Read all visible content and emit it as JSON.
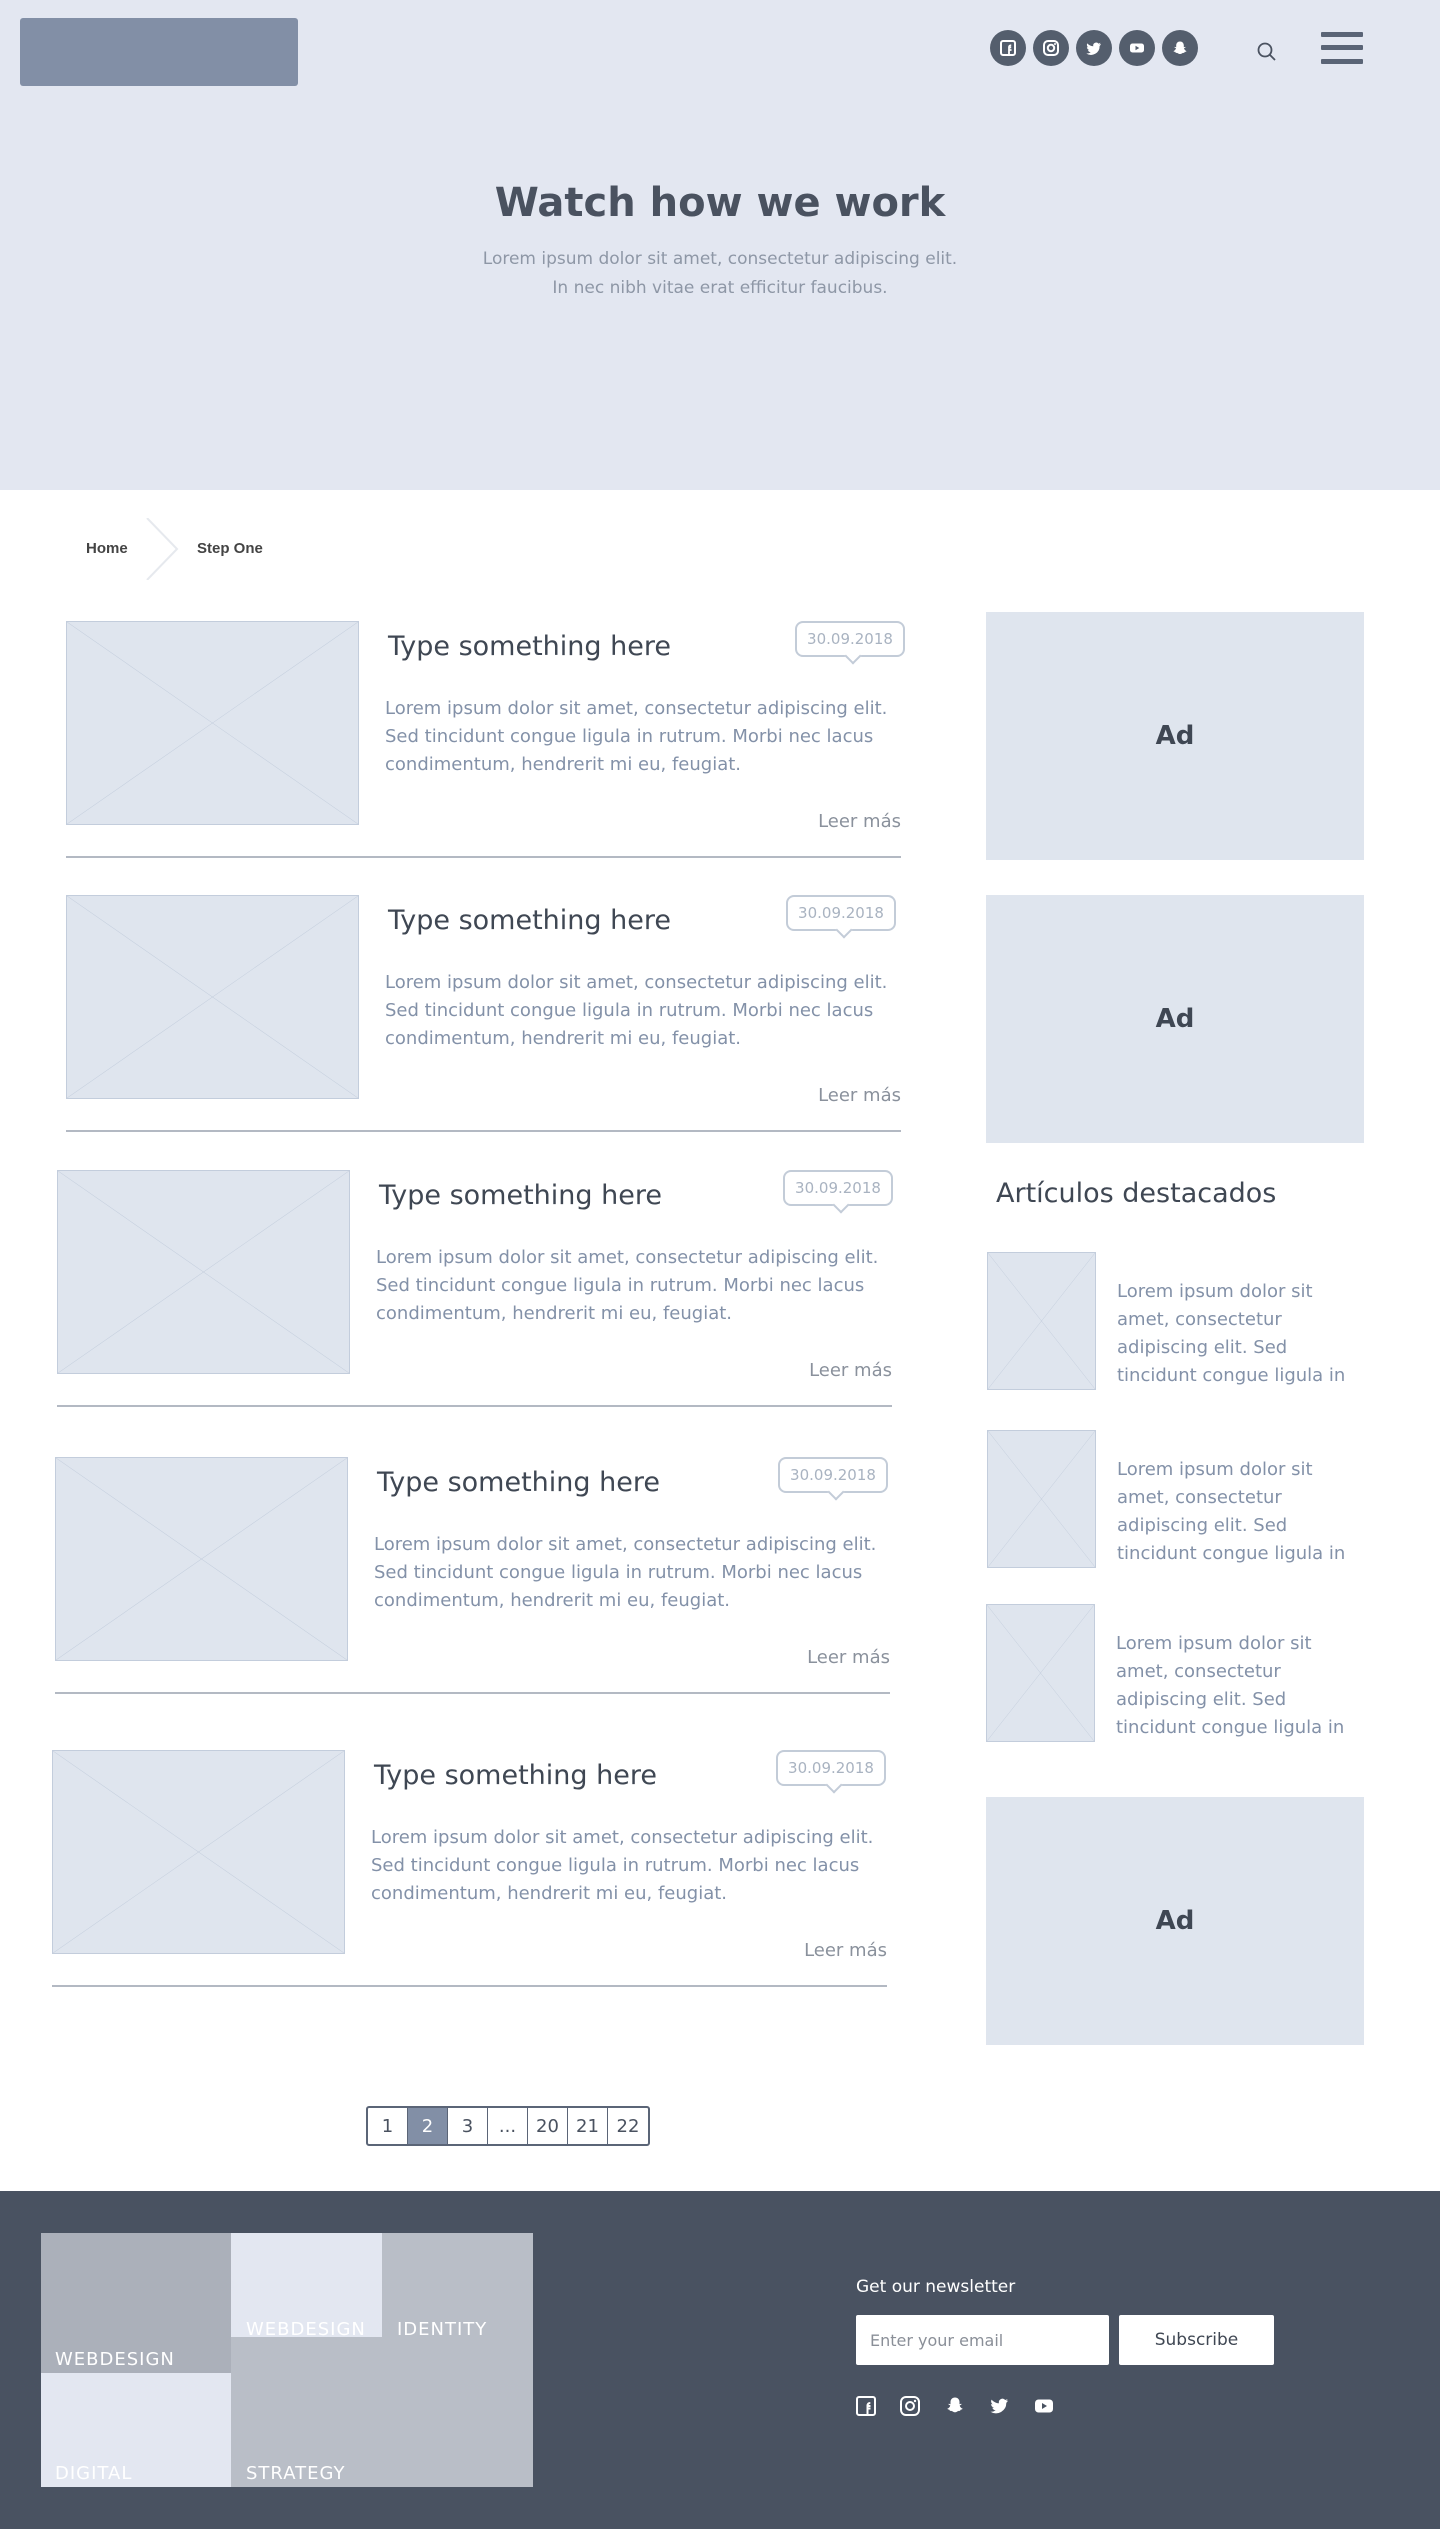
{
  "header": {
    "social": [
      "facebook-icon",
      "instagram-icon",
      "twitter-icon",
      "youtube-icon",
      "snapchat-icon"
    ]
  },
  "hero": {
    "title": "Watch how we work",
    "subtitle_line1": "Lorem ipsum dolor sit amet, consectetur adipiscing elit.",
    "subtitle_line2": "In nec nibh vitae erat efficitur faucibus."
  },
  "breadcrumb": {
    "home": "Home",
    "current": "Step One"
  },
  "articles": [
    {
      "title": "Type something here",
      "date": "30.09.2018",
      "excerpt": "Lorem ipsum dolor sit amet, consectetur adipiscing elit. Sed tincidunt congue ligula in rutrum. Morbi nec lacus condimentum, hendrerit mi eu, feugiat.",
      "more": "Leer más"
    },
    {
      "title": "Type something here",
      "date": "30.09.2018",
      "excerpt": "Lorem ipsum dolor sit amet, consectetur adipiscing elit. Sed tincidunt congue ligula in rutrum. Morbi nec lacus condimentum, hendrerit mi eu, feugiat.",
      "more": "Leer más"
    },
    {
      "title": "Type something here",
      "date": "30.09.2018",
      "excerpt": "Lorem ipsum dolor sit amet, consectetur adipiscing elit. Sed tincidunt congue ligula in rutrum. Morbi nec lacus condimentum, hendrerit mi eu, feugiat.",
      "more": "Leer más"
    },
    {
      "title": "Type something here",
      "date": "30.09.2018",
      "excerpt": "Lorem ipsum dolor sit amet, consectetur adipiscing elit. Sed tincidunt congue ligula in rutrum. Morbi nec lacus condimentum, hendrerit mi eu, feugiat.",
      "more": "Leer más"
    },
    {
      "title": "Type something here",
      "date": "30.09.2018",
      "excerpt": "Lorem ipsum dolor sit amet, consectetur adipiscing elit. Sed tincidunt congue ligula in rutrum. Morbi nec lacus condimentum, hendrerit mi eu, feugiat.",
      "more": "Leer más"
    }
  ],
  "sidebar": {
    "ads": [
      "Ad",
      "Ad",
      "Ad"
    ],
    "featured_title": "Artículos destacados",
    "featured": [
      {
        "text": "Lorem ipsum dolor sit amet, consectetur adipiscing elit. Sed tincidunt congue ligula in"
      },
      {
        "text": "Lorem ipsum dolor sit amet, consectetur adipiscing elit. Sed tincidunt congue ligula in"
      },
      {
        "text": "Lorem ipsum dolor sit amet, consectetur adipiscing elit. Sed tincidunt congue ligula in"
      }
    ]
  },
  "pagination": {
    "pages": [
      "1",
      "2",
      "3",
      "...",
      "20",
      "21",
      "22"
    ],
    "current": "2"
  },
  "footer": {
    "tiles": [
      "WEBDESIGN",
      "WEBDESIGN",
      "IDENTITY",
      "DIGITAL",
      "STRATEGY"
    ],
    "newsletter_label": "Get our newsletter",
    "email_placeholder": "Enter your email",
    "subscribe_label": "Subscribe",
    "social": [
      "facebook-icon",
      "instagram-icon",
      "snapchat-icon",
      "twitter-icon",
      "youtube-icon"
    ]
  },
  "colors": {
    "hero_bg": "#e3e7f1",
    "accent": "#828fa6",
    "footer_bg": "#495261",
    "placeholder_bg": "#dfe5ee"
  }
}
